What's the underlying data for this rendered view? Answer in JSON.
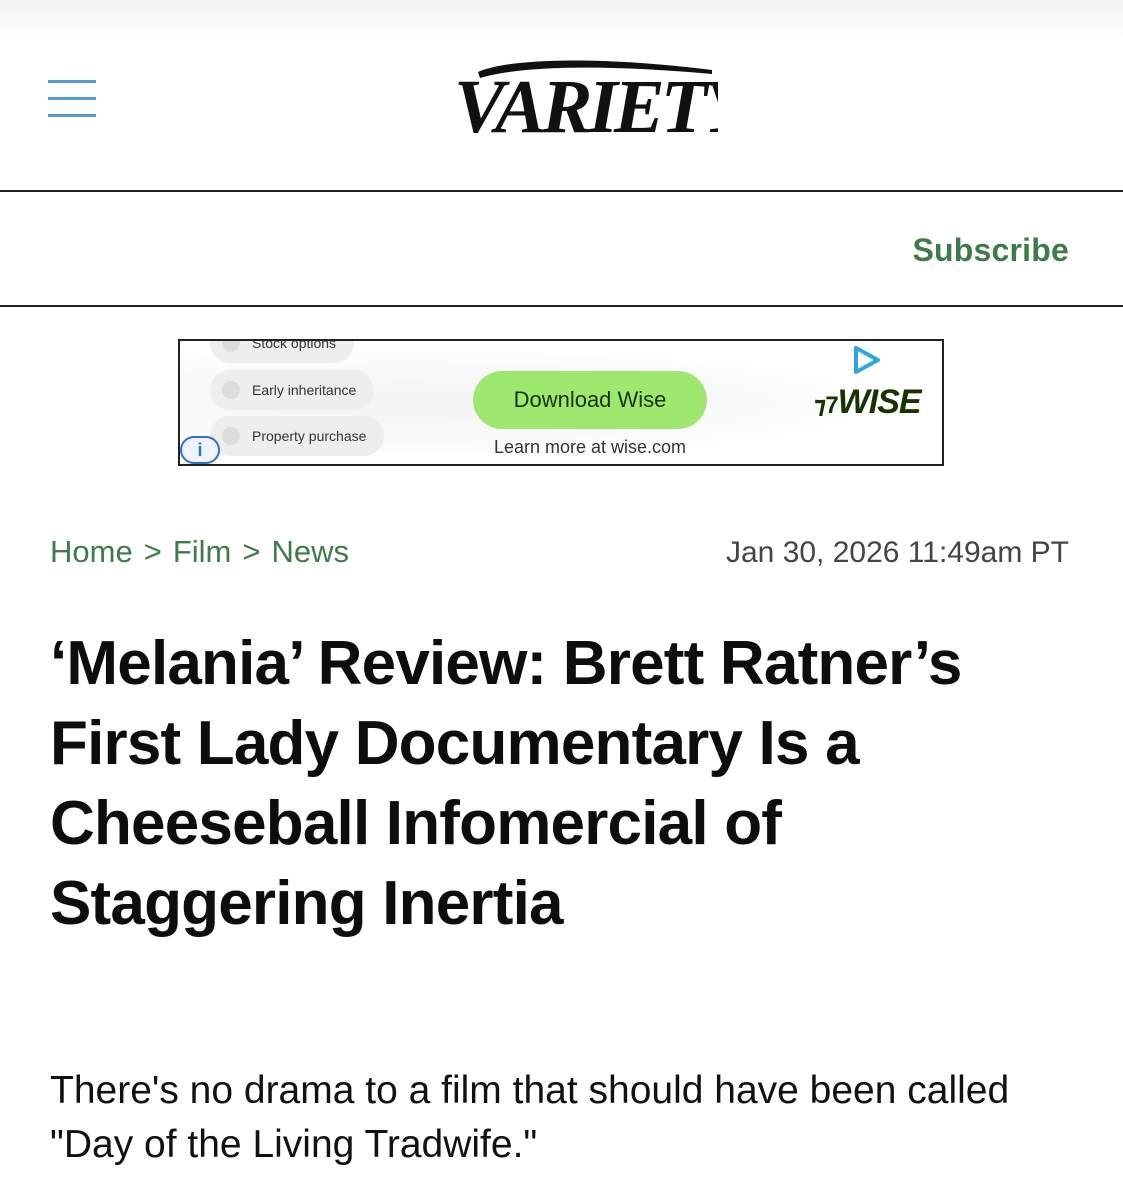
{
  "header": {
    "logo_text": "VARIETY",
    "subscribe_label": "Subscribe"
  },
  "ad": {
    "pills": [
      "Stock options",
      "Early inheritance",
      "Property purchase"
    ],
    "cta_label": "Download Wise",
    "learn_more": "Learn more at wise.com",
    "brand": "WISE",
    "info_label": "i",
    "colors": {
      "cta_bg": "#9fe870",
      "brand": "#163300"
    }
  },
  "breadcrumb": {
    "items": [
      "Home",
      "Film",
      "News"
    ],
    "separator": ">"
  },
  "article": {
    "date": "Jan 30, 2026 11:49am PT",
    "headline": "‘Melania’ Review: Brett Ratner’s First Lady Documentary Is a Cheeseball Infomercial of Staggering Inertia",
    "dek": "There's no drama to a film that should have been called \"Day of the Living Tradwife.\""
  },
  "colors": {
    "accent_green": "#3f7a4a",
    "menu_blue": "#5b9bd5"
  }
}
